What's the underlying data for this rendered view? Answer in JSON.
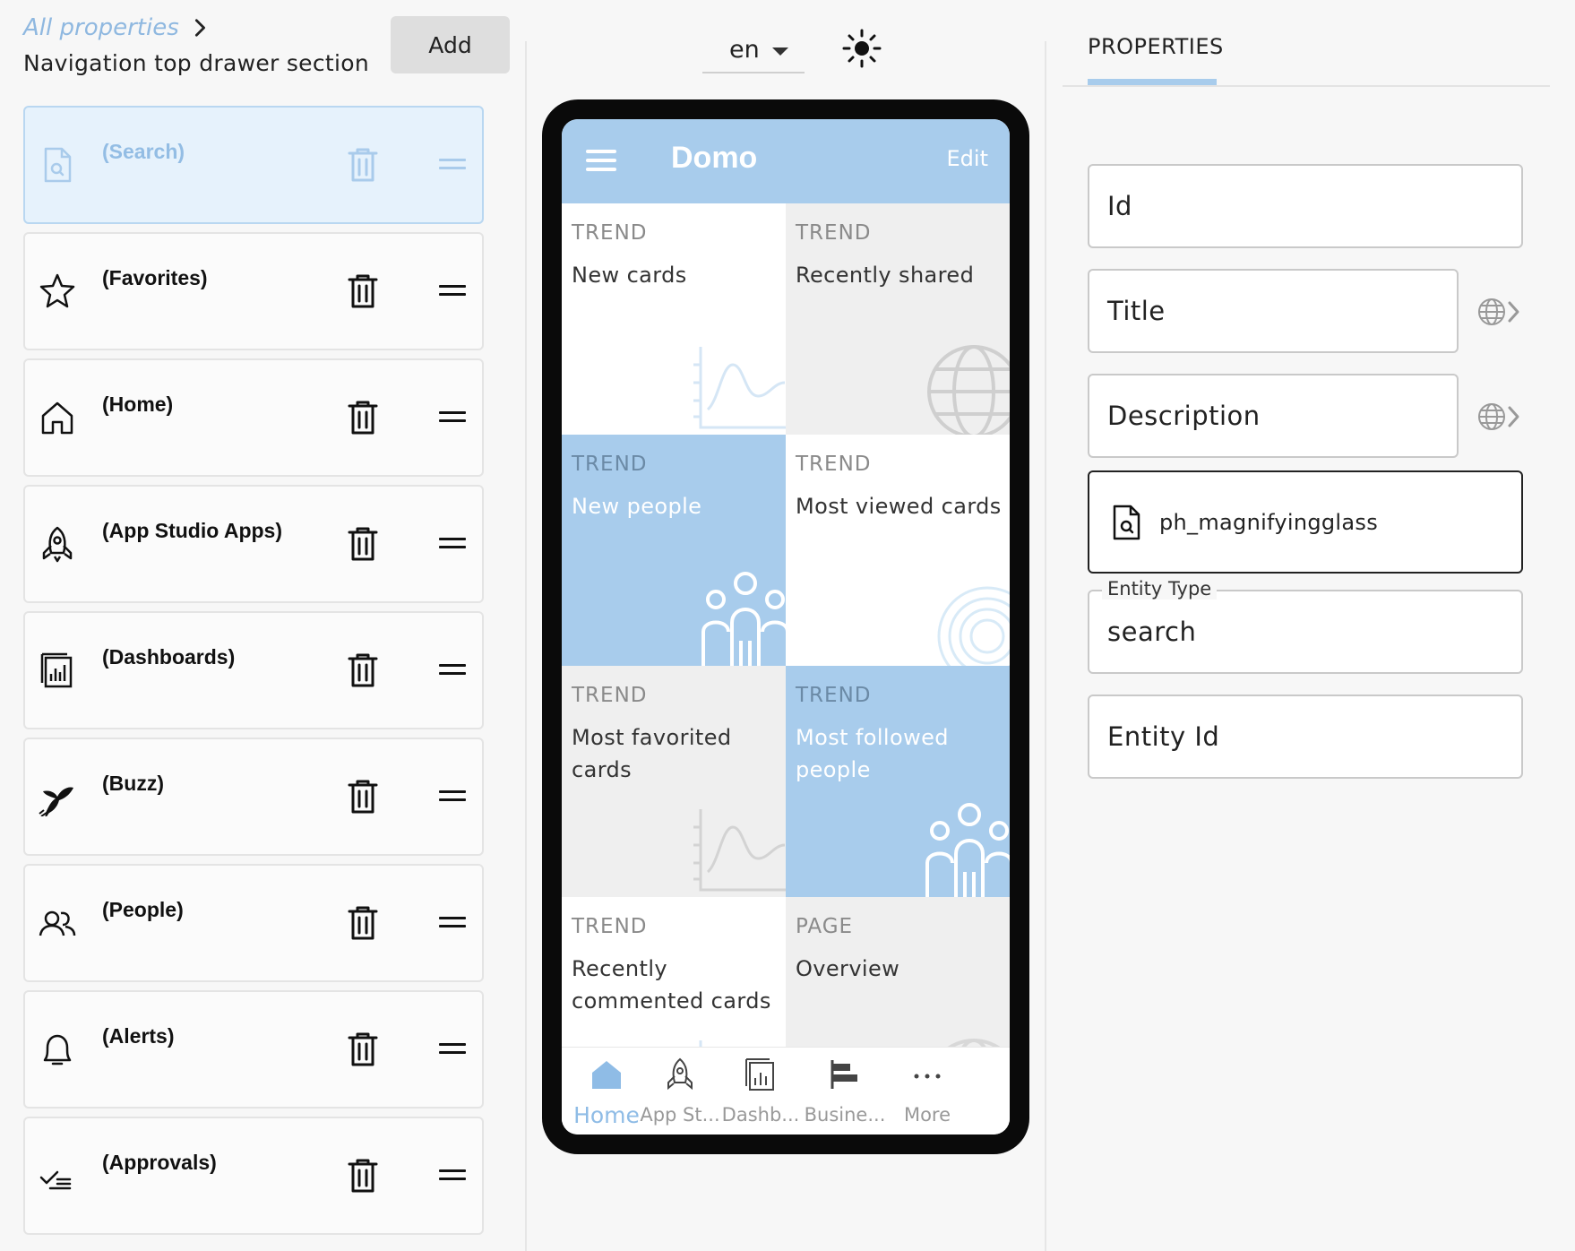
{
  "left_panel": {
    "breadcrumb_link": "All properties",
    "section_title": "Navigation top drawer section",
    "add_label": "Add",
    "items": [
      {
        "label": "(Search)",
        "icon": "search-file-icon",
        "selected": true
      },
      {
        "label": "(Favorites)",
        "icon": "star-icon"
      },
      {
        "label": "(Home)",
        "icon": "home-icon"
      },
      {
        "label": "(App Studio Apps)",
        "icon": "rocket-icon"
      },
      {
        "label": "(Dashboards)",
        "icon": "dashboard-icon"
      },
      {
        "label": "(Buzz)",
        "icon": "bee-icon"
      },
      {
        "label": "(People)",
        "icon": "people-icon"
      },
      {
        "label": "(Alerts)",
        "icon": "bell-icon"
      },
      {
        "label": "(Approvals)",
        "icon": "approvals-icon"
      }
    ]
  },
  "toolbar": {
    "language": "en",
    "theme_icon": "sun-icon"
  },
  "phone": {
    "app_title": "Domo",
    "edit_label": "Edit",
    "tiles": [
      {
        "kind": "TREND",
        "name": "New cards",
        "style": "white",
        "deco": "trend-chart-icon"
      },
      {
        "kind": "TREND",
        "name": "Recently shared",
        "style": "grey",
        "deco": "globe-icon"
      },
      {
        "kind": "TREND",
        "name": "New people",
        "style": "blue",
        "deco": "people-icon"
      },
      {
        "kind": "TREND",
        "name": "Most viewed cards",
        "style": "white",
        "deco": "eye-rings-icon"
      },
      {
        "kind": "TREND",
        "name": "Most favorited cards",
        "style": "grey",
        "deco": "trend-chart-icon"
      },
      {
        "kind": "TREND",
        "name": "Most followed people",
        "style": "blue",
        "deco": "people-icon"
      },
      {
        "kind": "TREND",
        "name": "Recently commented cards",
        "style": "white",
        "deco": "trend-chart-icon"
      },
      {
        "kind": "PAGE",
        "name": "Overview",
        "style": "grey",
        "deco": "globe-icon"
      }
    ],
    "tabs": [
      {
        "label": "Home",
        "icon": "home-icon",
        "active": true
      },
      {
        "label": "App St...",
        "icon": "rocket-icon"
      },
      {
        "label": "Dashb...",
        "icon": "dashboard-icon"
      },
      {
        "label": "Busine...",
        "icon": "business-icon"
      },
      {
        "label": "More",
        "icon": "more-dots-icon"
      }
    ],
    "colors": {
      "accent": "#a8ccec",
      "tab_active": "#8fbce6"
    }
  },
  "right_panel": {
    "tab_label": "PROPERTIES",
    "fields": {
      "id_label": "Id",
      "title_label": "Title",
      "description_label": "Description",
      "icon_value": "ph_magnifyingglass",
      "entity_type_legend": "Entity Type",
      "entity_type_value": "search",
      "entity_id_label": "Entity Id"
    }
  }
}
